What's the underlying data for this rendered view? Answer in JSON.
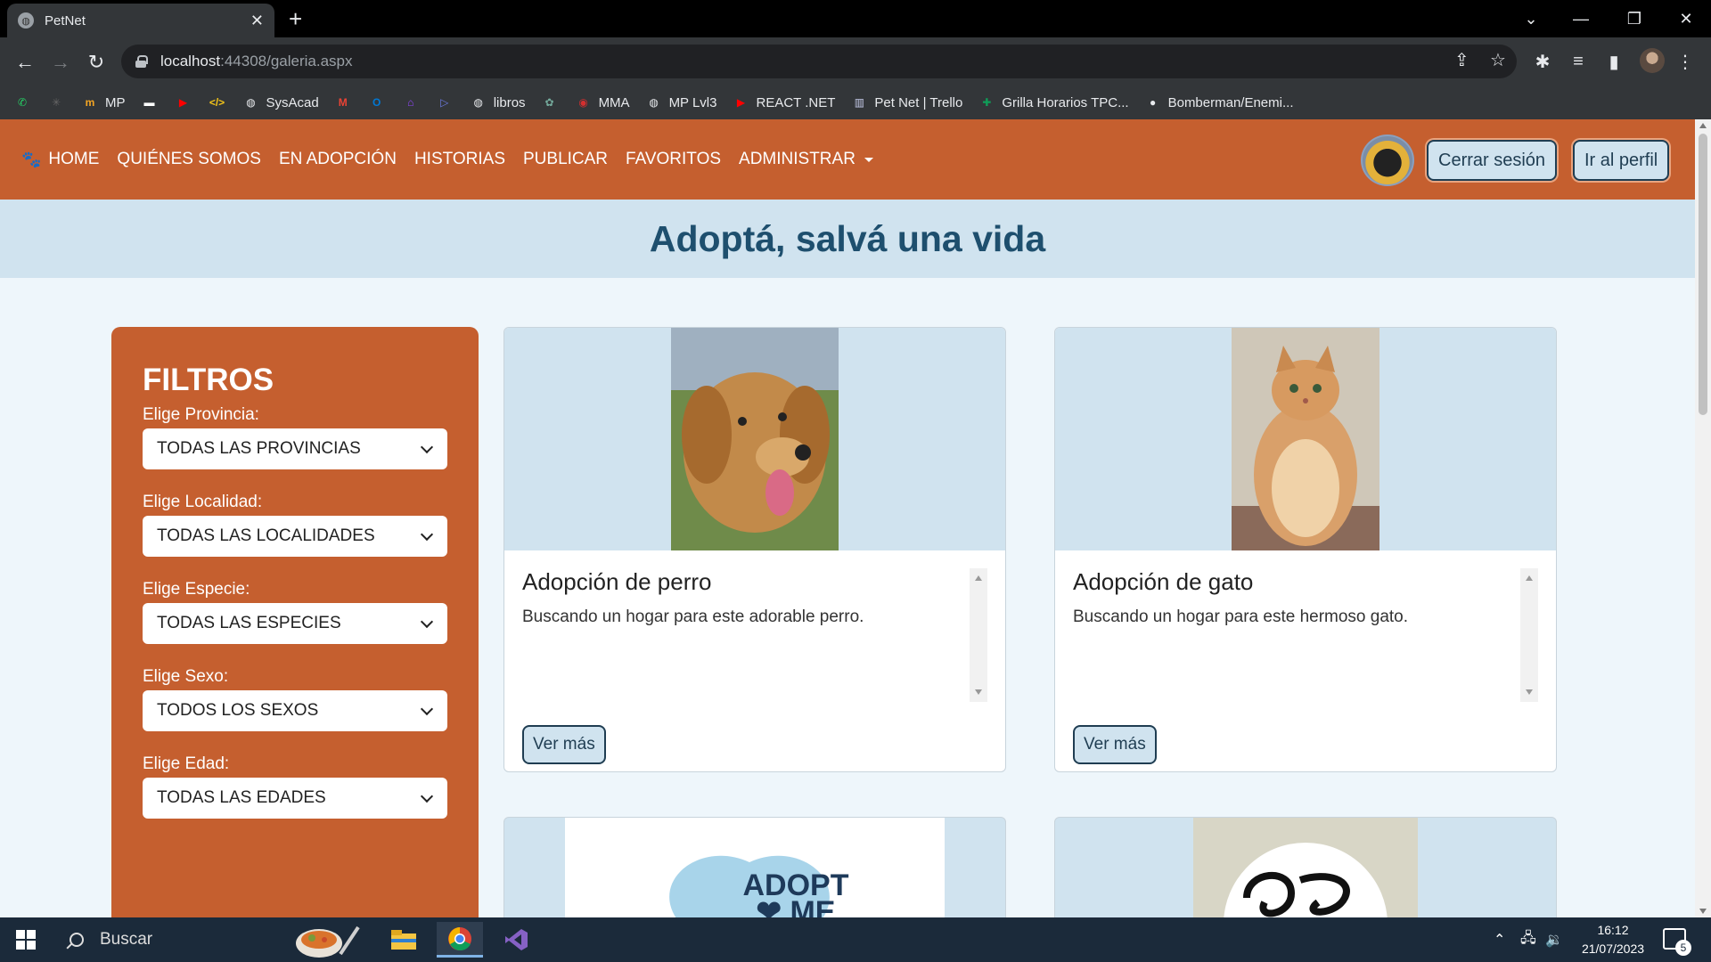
{
  "browser": {
    "tab_title": "PetNet",
    "url_host": "localhost",
    "url_rest": ":44308/galeria.aspx",
    "bookmarks": [
      {
        "label": "",
        "icon": "whatsapp-icon",
        "color": "#25d366"
      },
      {
        "label": "",
        "icon": "asterisk-icon",
        "color": "#666"
      },
      {
        "label": "MP",
        "icon": "mp-icon",
        "color": "#f5a623"
      },
      {
        "label": "",
        "icon": "dash-icon",
        "color": "#ffffff"
      },
      {
        "label": "",
        "icon": "youtube-icon",
        "color": "#ff0000"
      },
      {
        "label": "",
        "icon": "code-icon",
        "color": "#f5c518"
      },
      {
        "label": "SysAcad",
        "icon": "globe-icon",
        "color": "#e8eaed"
      },
      {
        "label": "",
        "icon": "gmail-icon",
        "color": "#ea4335"
      },
      {
        "label": "",
        "icon": "outlook-icon",
        "color": "#0078d4"
      },
      {
        "label": "",
        "icon": "twitch-icon",
        "color": "#9146ff"
      },
      {
        "label": "",
        "icon": "play-icon",
        "color": "#6c7ae0"
      },
      {
        "label": "libros",
        "icon": "globe-icon",
        "color": "#e8eaed"
      },
      {
        "label": "",
        "icon": "chatgpt-icon",
        "color": "#74aa9c"
      },
      {
        "label": "MMA",
        "icon": "ufc-icon",
        "color": "#d32f2f"
      },
      {
        "label": "MP Lvl3",
        "icon": "globe-icon",
        "color": "#e8eaed"
      },
      {
        "label": "REACT .NET",
        "icon": "youtube-icon",
        "color": "#ff0000"
      },
      {
        "label": "Pet Net | Trello",
        "icon": "trello-icon",
        "color": "#c5cae9"
      },
      {
        "label": "Grilla Horarios TPC...",
        "icon": "sheets-icon",
        "color": "#0f9d58"
      },
      {
        "label": "Bomberman/Enemi...",
        "icon": "github-icon",
        "color": "#e8eaed"
      }
    ]
  },
  "site": {
    "nav": {
      "home": "HOME",
      "quienes": "QUIÉNES SOMOS",
      "adopcion": "EN ADOPCIÓN",
      "historias": "HISTORIAS",
      "publicar": "PUBLICAR",
      "favoritos": "FAVORITOS",
      "administrar": "ADMINISTRAR",
      "logout": "Cerrar sesión",
      "profile": "Ir al perfil"
    },
    "hero_title": "Adoptá, salvá una vida",
    "filters": {
      "title": "FILTROS",
      "provincia_label": "Elige Provincia:",
      "provincia_value": "TODAS LAS PROVINCIAS",
      "localidad_label": "Elige Localidad:",
      "localidad_value": "TODAS LAS LOCALIDADES",
      "especie_label": "Elige Especie:",
      "especie_value": "TODAS LAS ESPECIES",
      "sexo_label": "Elige Sexo:",
      "sexo_value": "TODOS LOS SEXOS",
      "edad_label": "Elige Edad:",
      "edad_value": "TODAS LAS EDADES"
    },
    "cards": [
      {
        "title": "Adopción de perro",
        "text": "Buscando un hogar para este adorable perro.",
        "button": "Ver más"
      },
      {
        "title": "Adopción de gato",
        "text": "Buscando un hogar para este hermoso gato.",
        "button": "Ver más"
      }
    ],
    "partial_cards": [
      {
        "logo_text": "ADOPT ME"
      }
    ]
  },
  "taskbar": {
    "search": "Buscar",
    "time": "16:12",
    "date": "21/07/2023",
    "notifications": "5"
  },
  "colors": {
    "brand_orange": "#c55f2f",
    "light_blue": "#d0e3ef",
    "dark_blue": "#1f3d52"
  }
}
